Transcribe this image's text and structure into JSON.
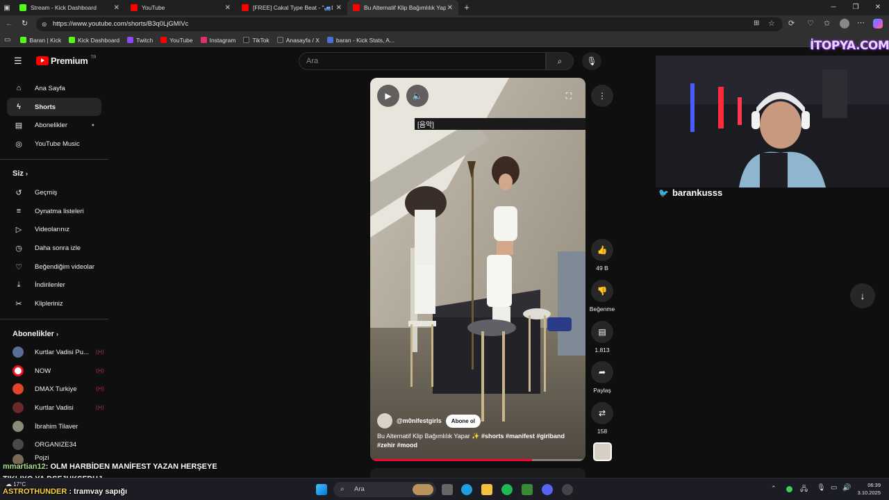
{
  "browser": {
    "tabs": [
      {
        "title": "Stream - Kick Dashboard",
        "color": "#53fc18"
      },
      {
        "title": "YouTube",
        "color": "#ff0000"
      },
      {
        "title": "[FREE] Cakal Type Beat - \"🚙LİMA",
        "color": "#ff0000"
      },
      {
        "title": "Bu Alternatif Klip Bağımlılık Yapar",
        "color": "#ff0000"
      }
    ],
    "new_tab": "+",
    "url": "https://www.youtube.com/shorts/B3q0LjGMIVc",
    "bookmarks": [
      {
        "label": "Baran | Kick",
        "color": "#53fc18"
      },
      {
        "label": "Kick Dashboard",
        "color": "#53fc18"
      },
      {
        "label": "Twitch",
        "color": "#9146ff"
      },
      {
        "label": "YouTube",
        "color": "#ff0000"
      },
      {
        "label": "Instagram",
        "color": "#e1306c"
      },
      {
        "label": "TikTok",
        "color": "#222222"
      },
      {
        "label": "Anasayfa / X",
        "color": "#333333"
      },
      {
        "label": "baran - Kick Stats, A...",
        "color": "#4a6fd6"
      }
    ]
  },
  "youtube": {
    "logo_text": "Premium",
    "logo_sup": "TR",
    "search_placeholder": "Ara",
    "sidebar_main": [
      {
        "label": "Ana Sayfa",
        "icon": "⌂"
      },
      {
        "label": "Shorts",
        "icon": "ϟ"
      },
      {
        "label": "Abonelikler",
        "icon": "▤"
      },
      {
        "label": "YouTube Music",
        "icon": "◎"
      }
    ],
    "you_title": "Siz",
    "sidebar_you": [
      {
        "label": "Geçmiş",
        "icon": "↺"
      },
      {
        "label": "Oynatma listeleri",
        "icon": "≡"
      },
      {
        "label": "Videolarınız",
        "icon": "▷"
      },
      {
        "label": "Daha sonra izle",
        "icon": "◷"
      },
      {
        "label": "Beğendiğim videolar",
        "icon": "👍"
      },
      {
        "label": "İndirilenler",
        "icon": "⤓"
      },
      {
        "label": "Klipleriniz",
        "icon": "✂"
      }
    ],
    "subs_title": "Abonelikler",
    "subscriptions": [
      {
        "label": "Kurtlar Vadisi Pu...",
        "color": "#5a6e9a",
        "live": true
      },
      {
        "label": "NOW",
        "color": "#ffffff",
        "live": true
      },
      {
        "label": "DMAX Turkiye",
        "color": "#e0452a",
        "live": true
      },
      {
        "label": "Kurtlar Vadisi",
        "color": "#6b2a2a",
        "live": true
      },
      {
        "label": "İbrahim Tilaver",
        "color": "#8a8a7a",
        "live": false
      },
      {
        "label": "ORGANIZE34",
        "color": "#4a4a4a",
        "live": false
      },
      {
        "label": "Pojzi",
        "color": "#7a6a55",
        "live": false
      }
    ],
    "short": {
      "caption": "[음악]",
      "channel": "@m0nifestgirls",
      "subscribe": "Abone ol",
      "title": "Bu Alternatif Klip Bağımlılık Yapar ✨ ",
      "hashtags1": "#shorts #manifest #girlband",
      "hashtags2": "#zehir #mood",
      "progress": 0.75
    },
    "actions": [
      {
        "icon": "👍",
        "label": "49 B"
      },
      {
        "icon": "👎",
        "label": "Beğenme"
      },
      {
        "icon": "▤",
        "label": "1.813"
      },
      {
        "icon": "➦",
        "label": "Paylaş"
      },
      {
        "icon": "⇄",
        "label": "158"
      }
    ]
  },
  "stream": {
    "logo": "İTOPYA.COM",
    "twitter": "barankusss",
    "chat": [
      {
        "user": "mmartian12",
        "user_color": "#a8e08a",
        "message": ": OLM HARBİDEN MANİFEST YAZAN HERŞEYE"
      },
      {
        "user": "",
        "user_color": "#ffffff",
        "message": "TIKLIYO YA DSFJHKSFDHJ"
      },
      {
        "user": "ASTROTHUNDER",
        "user_color": "#ffd23f",
        "message": " : tramvay sapığı"
      }
    ]
  },
  "taskbar": {
    "search": "Ara",
    "weather": "17°C",
    "time": "06:39",
    "date": "3.10.2025"
  }
}
